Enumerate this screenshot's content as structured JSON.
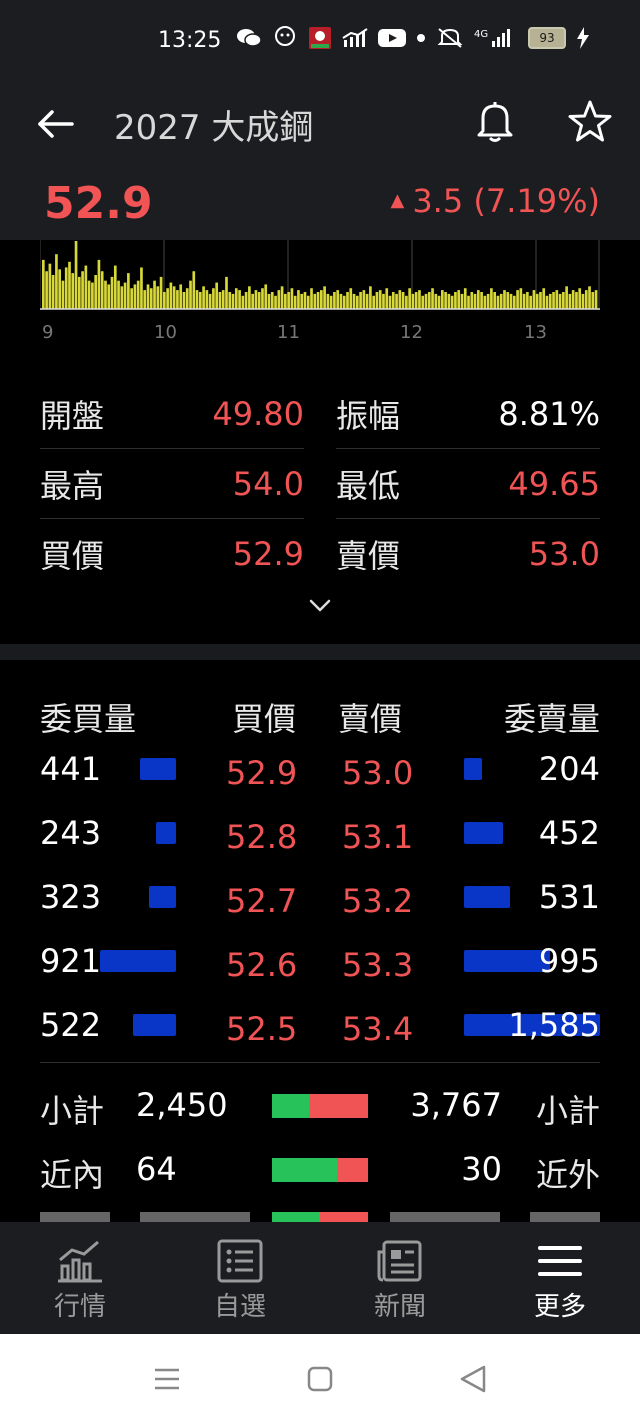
{
  "status": {
    "time": "13:25",
    "battery": "93"
  },
  "header": {
    "title": "2027 大成鋼",
    "price": "52.9",
    "change": "3.5 (7.19%)"
  },
  "chart_data": {
    "type": "bar",
    "title": "",
    "x_ticks": [
      "9",
      "10",
      "11",
      "12",
      "13"
    ],
    "xlabel": "",
    "ylabel": "",
    "x_range": [
      9,
      13.5
    ],
    "bar_color": "#d8d838",
    "values": [
      52,
      40,
      48,
      36,
      58,
      42,
      30,
      44,
      50,
      38,
      72,
      34,
      40,
      46,
      30,
      28,
      36,
      52,
      40,
      30,
      26,
      34,
      46,
      30,
      24,
      28,
      38,
      22,
      26,
      30,
      44,
      20,
      26,
      22,
      30,
      24,
      34,
      18,
      22,
      28,
      24,
      20,
      26,
      18,
      22,
      30,
      40,
      20,
      18,
      24,
      20,
      16,
      22,
      28,
      18,
      20,
      34,
      18,
      16,
      22,
      20,
      14,
      18,
      24,
      16,
      20,
      18,
      22,
      26,
      16,
      18,
      14,
      20,
      24,
      16,
      18,
      22,
      14,
      20,
      16,
      18,
      14,
      22,
      16,
      18,
      20,
      24,
      16,
      14,
      18,
      20,
      16,
      14,
      18,
      22,
      16,
      14,
      18,
      20,
      16,
      24,
      14,
      18,
      20,
      16,
      22,
      14,
      18,
      16,
      20,
      18,
      14,
      22,
      16,
      18,
      20,
      14,
      16,
      18,
      22,
      16,
      14,
      20,
      18,
      16,
      14,
      18,
      20,
      16,
      22,
      14,
      18,
      16,
      20,
      18,
      14,
      16,
      22,
      18,
      14,
      16,
      20,
      18,
      16,
      14,
      20,
      22,
      16,
      18,
      14,
      20,
      16,
      18,
      22,
      14,
      16,
      18,
      20,
      16,
      18,
      24,
      16,
      20,
      18,
      22,
      16,
      20,
      24,
      18,
      20
    ]
  },
  "stats": [
    {
      "label": "開盤",
      "value": "49.80",
      "label2": "振幅",
      "value2": "8.81%"
    },
    {
      "label": "最高",
      "value": "54.0",
      "label2": "最低",
      "value2": "49.65"
    },
    {
      "label": "買價",
      "value": "52.9",
      "label2": "賣價",
      "value2": "53.0"
    }
  ],
  "orderbook": {
    "headers": {
      "bid_qty": "委買量",
      "bid": "買價",
      "ask": "賣價",
      "ask_qty": "委賣量"
    },
    "rows": [
      {
        "bid_qty": "441",
        "bid": "52.9",
        "ask": "53.0",
        "ask_qty": "204"
      },
      {
        "bid_qty": "243",
        "bid": "52.8",
        "ask": "53.1",
        "ask_qty": "452"
      },
      {
        "bid_qty": "323",
        "bid": "52.7",
        "ask": "53.2",
        "ask_qty": "531"
      },
      {
        "bid_qty": "921",
        "bid": "52.6",
        "ask": "53.3",
        "ask_qty": "995"
      },
      {
        "bid_qty": "522",
        "bid": "52.5",
        "ask": "53.4",
        "ask_qty": "1,585"
      }
    ],
    "bid_bar_fraction": [
      0.48,
      0.26,
      0.35,
      1.0,
      0.57
    ],
    "ask_bar_fraction": [
      0.13,
      0.29,
      0.34,
      0.63,
      1.0
    ]
  },
  "summary": [
    {
      "label": "小計",
      "value": "2,450",
      "value2": "3,767",
      "label2": "小計",
      "green_fraction": 0.39
    },
    {
      "label": "近內",
      "value": "64",
      "value2": "30",
      "label2": "近外",
      "green_fraction": 0.68
    }
  ],
  "tabs": [
    {
      "label": "行情",
      "icon": "chart-icon"
    },
    {
      "label": "自選",
      "icon": "list-icon"
    },
    {
      "label": "新聞",
      "icon": "news-icon"
    },
    {
      "label": "更多",
      "icon": "menu-icon"
    }
  ],
  "colors": {
    "up": "#f05454",
    "bar_blue": "#0a36c8",
    "green": "#27c25a"
  }
}
